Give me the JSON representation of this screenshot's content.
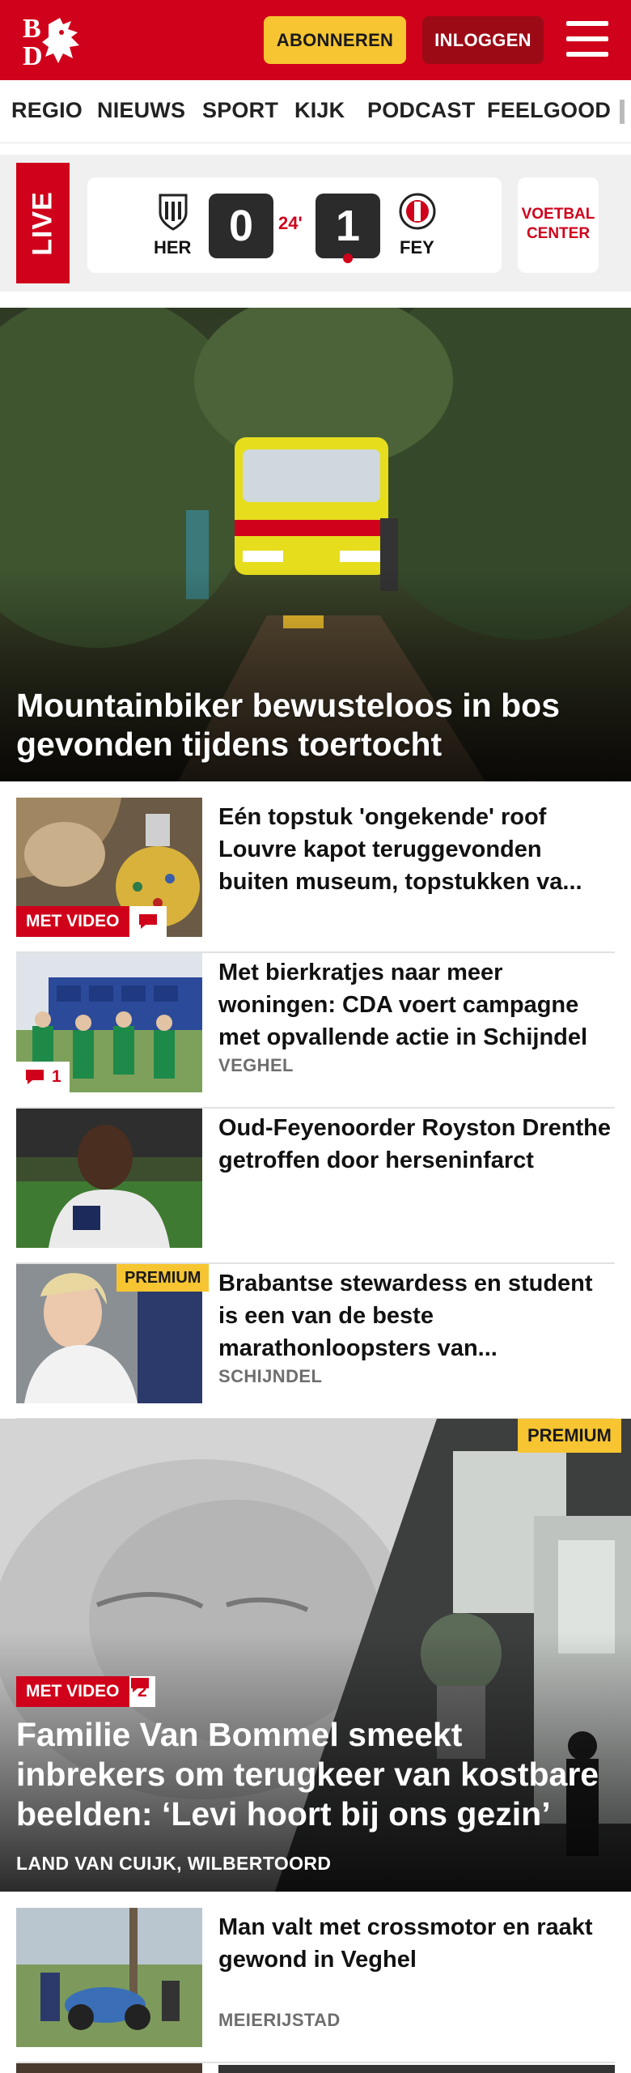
{
  "header": {
    "logo_text": "BD",
    "subscribe_label": "ABONNEREN",
    "login_label": "INLOGGEN",
    "brand_color": "#d0021b"
  },
  "nav": {
    "items": [
      "REGIO",
      "NIEUWS",
      "SPORT",
      "KIJK",
      "PODCAST",
      "FEELGOOD"
    ]
  },
  "live": {
    "label": "LIVE",
    "home_team": "HER",
    "home_score": "0",
    "minute": "24'",
    "away_score": "1",
    "away_team": "FEY",
    "center_label_line1": "VOETBAL",
    "center_label_line2": "CENTER"
  },
  "hero": {
    "title": "Mountainbiker bewusteloos in bos gevonden tijdens toertocht"
  },
  "articles": [
    {
      "title": "Eén topstuk 'ongekende' roof Louvre kapot teruggevonden buiten museum, topstukken va...",
      "badge_video": "MET VIDEO",
      "comments": ""
    },
    {
      "title": "Met bierkratjes naar meer woningen: CDA voert campagne met opvallende actie in Schijndel",
      "location": "VEGHEL",
      "comments": "1"
    },
    {
      "title": "Oud-Feyenoorder Royston Drenthe getroffen door hersenin­farct"
    },
    {
      "title": "Brabantse stewardess en student is een van de beste marathonloopsters van...",
      "location": "SCHIJNDEL",
      "premium": "PREMIUM"
    }
  ],
  "big_story": {
    "premium": "PREMIUM",
    "badge_video": "MET VIDEO",
    "comments": "2",
    "title": "Familie Van Bommel smeekt inbrekers om terugkeer van kostbare beelden: ‘Levi hoort bij ons gezin’",
    "location": "LAND VAN CUIJK, WILBERTOORD"
  },
  "article_after": {
    "title": "Man valt met crossmotor en raakt gewond in Veghel",
    "location": "MEIERIJSTAD"
  }
}
